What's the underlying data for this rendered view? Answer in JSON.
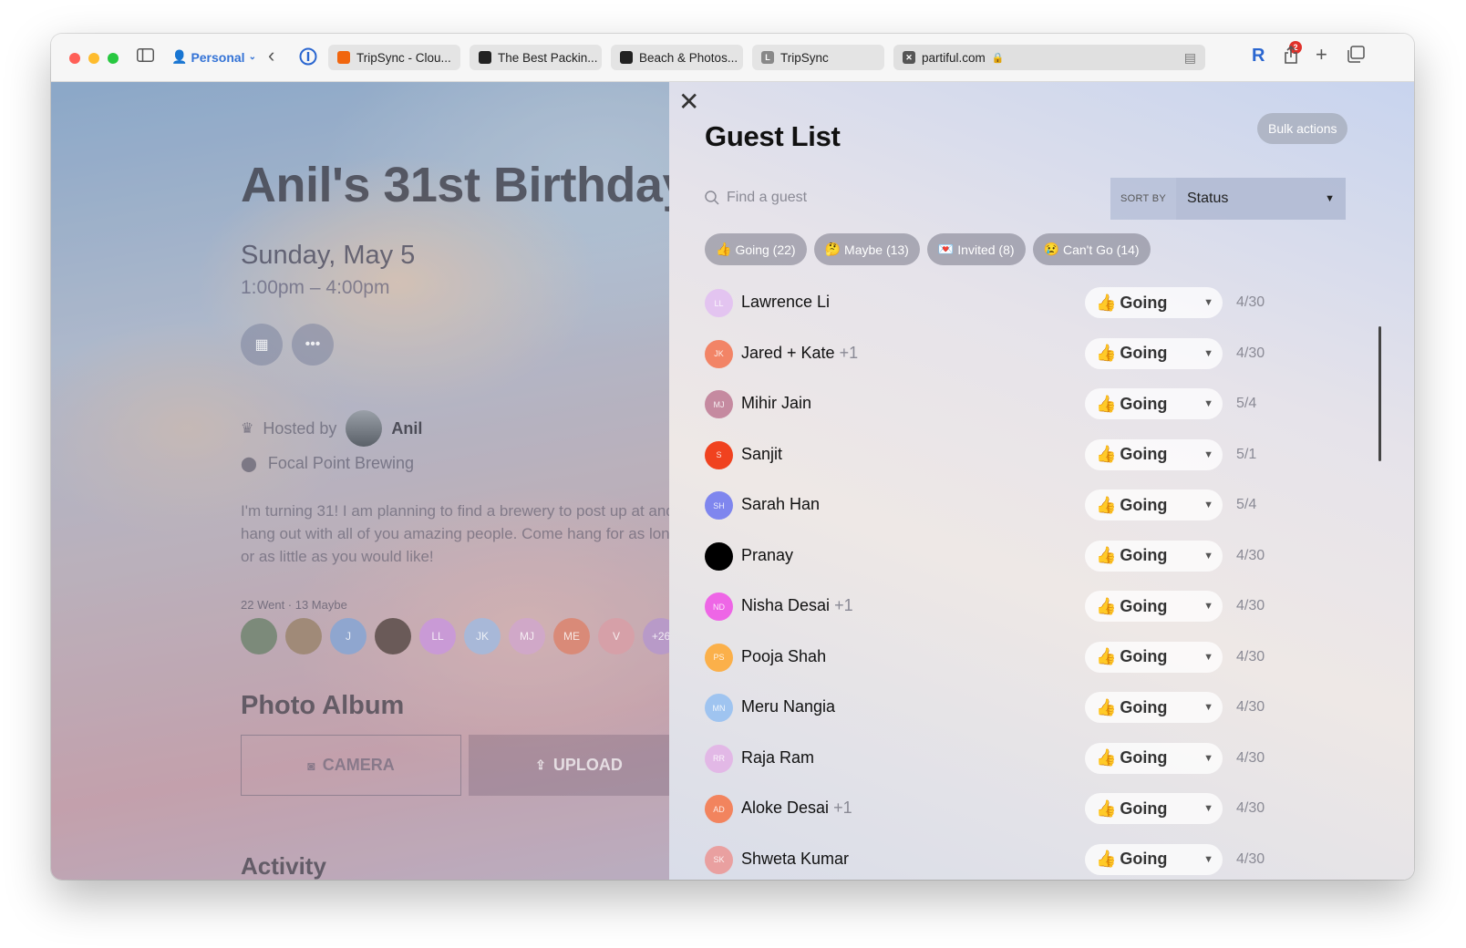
{
  "browser": {
    "profile": "Personal",
    "tabs": [
      {
        "label": "TripSync - Clou...",
        "fav_color": "#f1660f"
      },
      {
        "label": "The Best Packin...",
        "fav_color": "#222222"
      },
      {
        "label": "Beach & Photos...",
        "fav_color": "#222222"
      },
      {
        "label": "TripSync",
        "fav_color": "#888888"
      }
    ],
    "address": "partiful.com",
    "extension_badge": "2"
  },
  "event": {
    "title": "Anil's 31st Birthday",
    "date": "Sunday, May 5",
    "time": "1:00pm – 4:00pm",
    "hosted_by_label": "Hosted by",
    "host_name": "Anil",
    "location": "Focal Point Brewing",
    "description": "I'm turning 31! I am planning to find a brewery to post up at and hang out with all of you amazing people. Come hang for as long or as little as you would like!",
    "attendance_summary": "22 Went · 13 Maybe",
    "attendee_avatars": [
      {
        "initials": "",
        "color": "#7c8a7a"
      },
      {
        "initials": "",
        "color": "#a08a78"
      },
      {
        "initials": "J",
        "color": "#8fa6cf"
      },
      {
        "initials": "",
        "color": "#6a5a58"
      },
      {
        "initials": "LL",
        "color": "#c99ad6"
      },
      {
        "initials": "JK",
        "color": "#a8b8d8"
      },
      {
        "initials": "MJ",
        "color": "#d0a8c8"
      },
      {
        "initials": "ME",
        "color": "#d98a78"
      },
      {
        "initials": "V",
        "color": "#d6a0a8"
      },
      {
        "initials": "+26",
        "color": "#b89ac8"
      }
    ],
    "photo_album_title": "Photo Album",
    "camera_label": "CAMERA",
    "upload_label": "UPLOAD",
    "activity_title": "Activity"
  },
  "guest_list": {
    "title": "Guest List",
    "bulk_actions_label": "Bulk actions",
    "search_placeholder": "Find a guest",
    "sort_by_label": "SORT BY",
    "sort_value": "Status",
    "filters": [
      {
        "emoji": "👍",
        "label": "Going (22)"
      },
      {
        "emoji": "🤔",
        "label": "Maybe (13)"
      },
      {
        "emoji": "💌",
        "label": "Invited (8)"
      },
      {
        "emoji": "😢",
        "label": "Can't Go (14)"
      }
    ],
    "guests": [
      {
        "initials": "LL",
        "name": "Lawrence Li",
        "plus": "",
        "status": "Going",
        "date": "4/30",
        "color": "#e3c4f0"
      },
      {
        "initials": "JK",
        "name": "Jared + Kate",
        "plus": "+1",
        "status": "Going",
        "date": "4/30",
        "color": "#f28466"
      },
      {
        "initials": "MJ",
        "name": "Mihir Jain",
        "plus": "",
        "status": "Going",
        "date": "5/4",
        "color": "#c58aa0"
      },
      {
        "initials": "S",
        "name": "Sanjit",
        "plus": "",
        "status": "Going",
        "date": "5/1",
        "color": "#f0421f"
      },
      {
        "initials": "SH",
        "name": "Sarah Han",
        "plus": "",
        "status": "Going",
        "date": "5/4",
        "color": "#7f86ee"
      },
      {
        "initials": "",
        "name": "Pranay",
        "plus": "",
        "status": "Going",
        "date": "4/30",
        "color": "#000000"
      },
      {
        "initials": "ND",
        "name": "Nisha Desai",
        "plus": "+1",
        "status": "Going",
        "date": "4/30",
        "color": "#ee66e6"
      },
      {
        "initials": "PS",
        "name": "Pooja Shah",
        "plus": "",
        "status": "Going",
        "date": "4/30",
        "color": "#fbb04a"
      },
      {
        "initials": "MN",
        "name": "Meru Nangia",
        "plus": "",
        "status": "Going",
        "date": "4/30",
        "color": "#9fc4f0"
      },
      {
        "initials": "RR",
        "name": "Raja Ram",
        "plus": "",
        "status": "Going",
        "date": "4/30",
        "color": "#e2b8e6"
      },
      {
        "initials": "AD",
        "name": "Aloke Desai",
        "plus": "+1",
        "status": "Going",
        "date": "4/30",
        "color": "#f2845e"
      },
      {
        "initials": "SK",
        "name": "Shweta Kumar",
        "plus": "",
        "status": "Going",
        "date": "4/30",
        "color": "#e9a0a0"
      }
    ],
    "status_emoji": "👍"
  }
}
